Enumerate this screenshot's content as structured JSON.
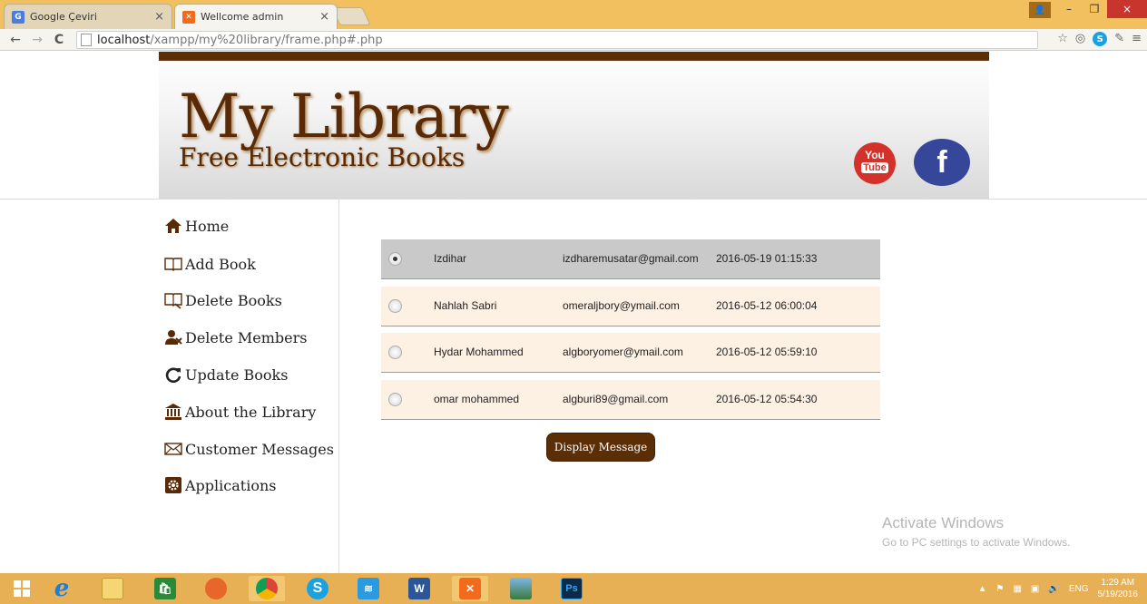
{
  "browser": {
    "tabs": [
      {
        "title": "Google Çeviri",
        "active": false
      },
      {
        "title": "Wellcome admin",
        "active": true
      }
    ],
    "tab_close_glyph": "×",
    "url_host": "localhost",
    "url_path": "/xampp/my%20library/frame.php#.php",
    "window_controls": {
      "minimize": "–",
      "restore": "❐",
      "close": "×"
    }
  },
  "header": {
    "title": "My Library",
    "subtitle": "Free Electronic Books",
    "youtube_top": "You",
    "youtube_bottom": "Tube",
    "facebook": "f"
  },
  "menu": [
    {
      "label": "Home",
      "icon": "home-icon"
    },
    {
      "label": "Add Book",
      "icon": "open-book-icon"
    },
    {
      "label": "Delete Books",
      "icon": "book-delete-icon"
    },
    {
      "label": "Delete Members",
      "icon": "user-delete-icon"
    },
    {
      "label": "Update Books",
      "icon": "refresh-icon"
    },
    {
      "label": "About the Library",
      "icon": "library-building-icon"
    },
    {
      "label": "Customer Messages",
      "icon": "envelope-icon"
    },
    {
      "label": "Applications",
      "icon": "gear-icon"
    }
  ],
  "messages": [
    {
      "name": "Izdihar",
      "email": "izdharemusatar@gmail.com",
      "date": "2016-05-19 01:15:33",
      "selected": true
    },
    {
      "name": "Nahlah Sabri",
      "email": "omeraljbory@ymail.com",
      "date": "2016-05-12 06:00:04",
      "selected": false
    },
    {
      "name": "Hydar Mohammed",
      "email": "algboryomer@ymail.com",
      "date": "2016-05-12 05:59:10",
      "selected": false
    },
    {
      "name": "omar mohammed",
      "email": "algburi89@gmail.com",
      "date": "2016-05-12 05:54:30",
      "selected": false
    }
  ],
  "display_button": "Display Message",
  "watermark": {
    "line1": "Activate Windows",
    "line2": "Go to PC settings to activate Windows."
  },
  "taskbar": {
    "apps": [
      "windows-start-icon",
      "internet-explorer-icon",
      "file-explorer-icon",
      "store-icon",
      "firefox-icon",
      "chrome-icon",
      "skype-icon",
      "wifi-icon",
      "word-icon",
      "xampp-icon",
      "photos-icon",
      "photoshop-icon"
    ],
    "lang": "ENG",
    "time": "1:29 AM",
    "date": "5/19/2016"
  },
  "colors": {
    "brand": "#5c2e05",
    "chrome_frame": "#f2c05e",
    "taskbar": "#e7b054",
    "row_bg": "#fdf1e4",
    "row_selected": "#c9c9c9"
  }
}
